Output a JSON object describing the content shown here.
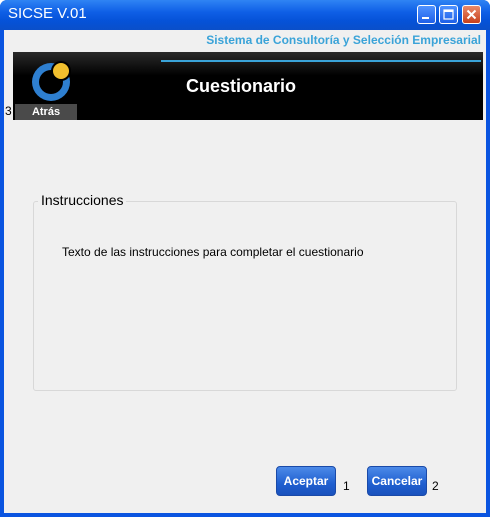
{
  "window": {
    "title": "SICSE V.01"
  },
  "header": {
    "tagline": "Sistema de Consultoría y Selección Empresarial",
    "title": "Cuestionario",
    "back_label": "Atrás",
    "back_shortcut": "3"
  },
  "instructions": {
    "group_title": "Instrucciones",
    "text": "Texto de las instrucciones para completar el cuestionario"
  },
  "actions": {
    "accept_label": "Aceptar",
    "accept_shortcut": "1",
    "cancel_label": "Cancelar",
    "cancel_shortcut": "2"
  },
  "colors": {
    "accent": "#3aa3d8",
    "button": "#1f5fd0",
    "titlebar": "#0552d8"
  }
}
